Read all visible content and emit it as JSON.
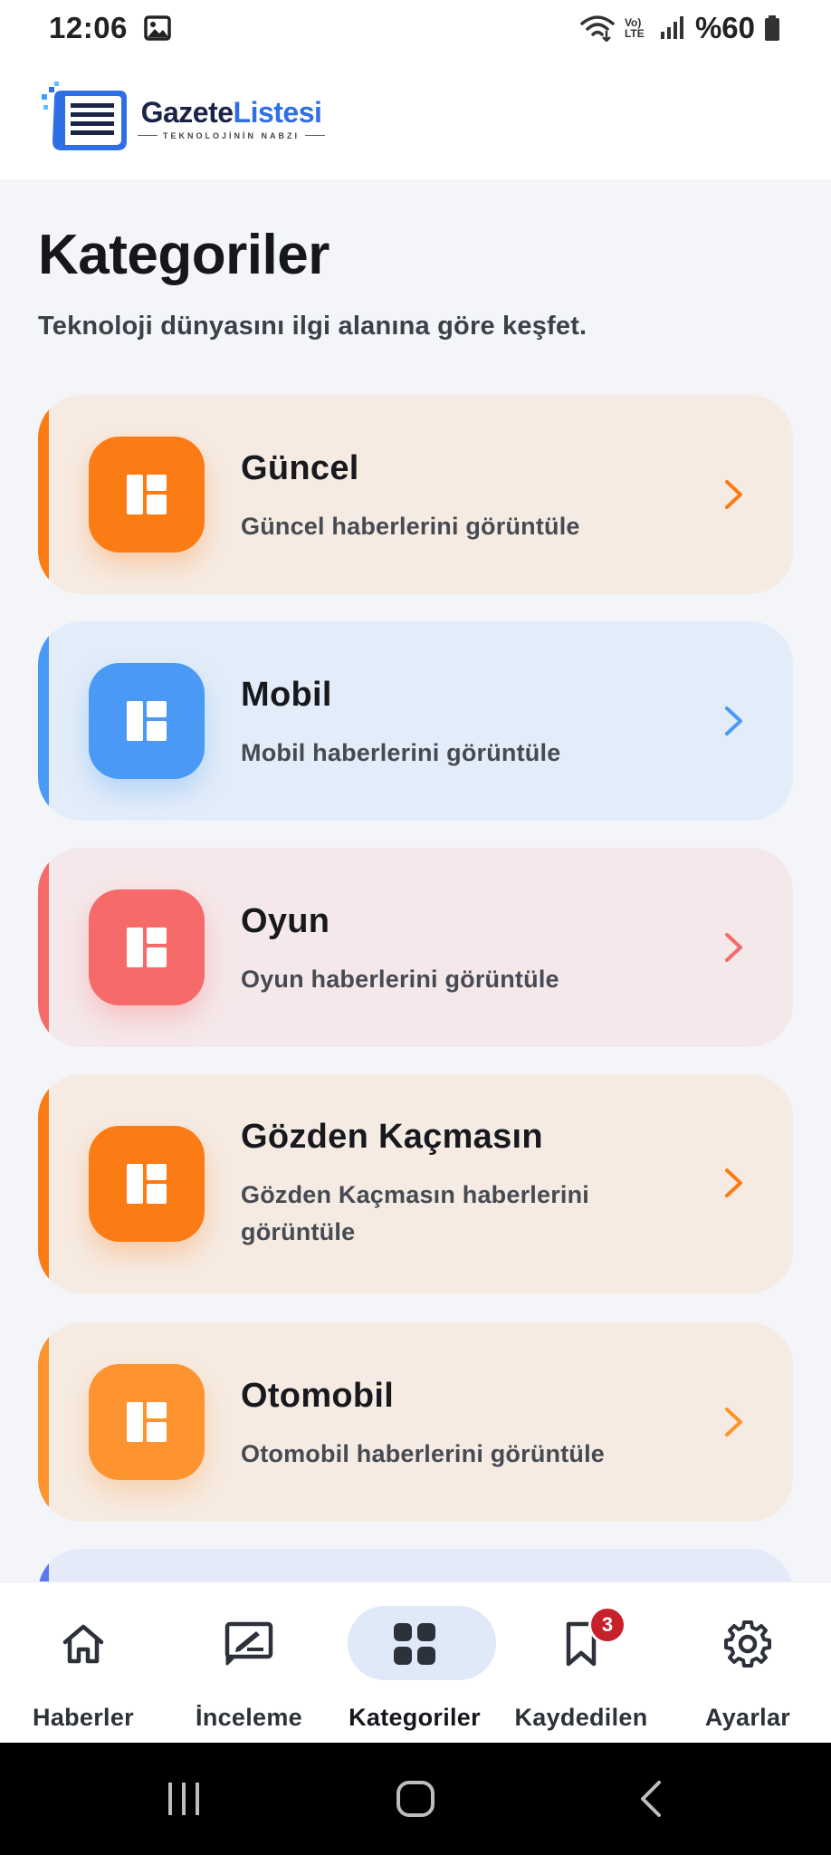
{
  "status_bar": {
    "time": "12:06",
    "battery_text": "%60",
    "network_text": "Vo) LTE"
  },
  "app": {
    "logo_part1": "Gazete",
    "logo_part2": "Listesi",
    "logo_tagline": "TEKNOLOJİNİN NABZI"
  },
  "page": {
    "title": "Kategoriler",
    "subtitle": "Teknoloji dünyasını ilgi alanına göre keşfet."
  },
  "categories": [
    {
      "title": "Güncel",
      "description": "Güncel haberlerini görüntüle",
      "color": "#fb7b14"
    },
    {
      "title": "Mobil",
      "description": "Mobil haberlerini görüntüle",
      "color": "#4a9af5"
    },
    {
      "title": "Oyun",
      "description": "Oyun haberlerini görüntüle",
      "color": "#f66a6a"
    },
    {
      "title": "Gözden Kaçmasın",
      "description": "Gözden Kaçmasın haberlerini görüntüle",
      "color": "#fb7b14"
    },
    {
      "title": "Otomobil",
      "description": "Otomobil haberlerini görüntüle",
      "color": "#fd9430"
    }
  ],
  "bottom_nav": [
    {
      "label": "Haberler",
      "icon": "home-icon"
    },
    {
      "label": "İnceleme",
      "icon": "review-icon"
    },
    {
      "label": "Kategoriler",
      "icon": "grid-icon",
      "active": true
    },
    {
      "label": "Kaydedilen",
      "icon": "bookmark-icon",
      "badge": "3"
    },
    {
      "label": "Ayarlar",
      "icon": "gear-icon"
    }
  ],
  "colors": {
    "accent_active_pill": "#e0e9f8",
    "badge": "#c8202a",
    "background": "#f3f5f9"
  }
}
